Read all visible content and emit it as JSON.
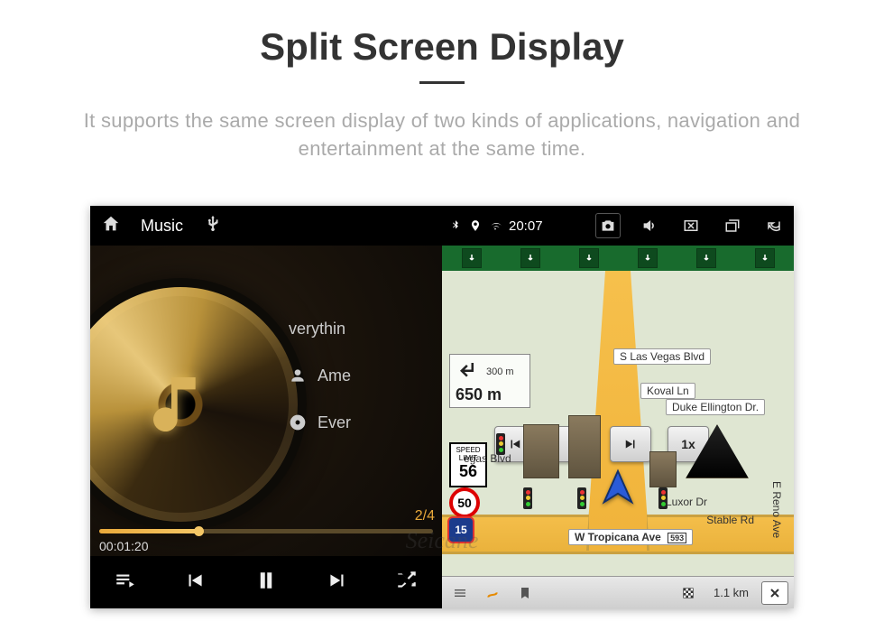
{
  "header": {
    "title": "Split Screen Display",
    "subtitle": "It supports the same screen display of two kinds of applications, navigation and entertainment at the same time."
  },
  "music": {
    "topbar_title": "Music",
    "track_title": "verythin",
    "artist": "Ame",
    "album": "Ever",
    "track_index": "2/4",
    "elapsed": "00:01:20"
  },
  "nav": {
    "clock": "20:07",
    "turn": {
      "small_dist": "300 m",
      "main_dist": "650 m"
    },
    "speed_limit_label": "SPEED LIMIT",
    "speed_limit": "56",
    "speed_round": "50",
    "interstate": "15",
    "playback_speed": "1x",
    "streets": {
      "vegas": "S Las Vegas Blvd",
      "koval": "Koval Ln",
      "duke": "Duke Ellington Dr.",
      "egas": "egas Blvd",
      "luxor": "Luxor Dr",
      "stable": "Stable Rd",
      "reno": "E Reno Ave",
      "tropicana": "W Tropicana Ave",
      "tropicana_exit": "593"
    },
    "bottom": {
      "distance": "1.1 km"
    }
  },
  "watermark": "Seicane"
}
